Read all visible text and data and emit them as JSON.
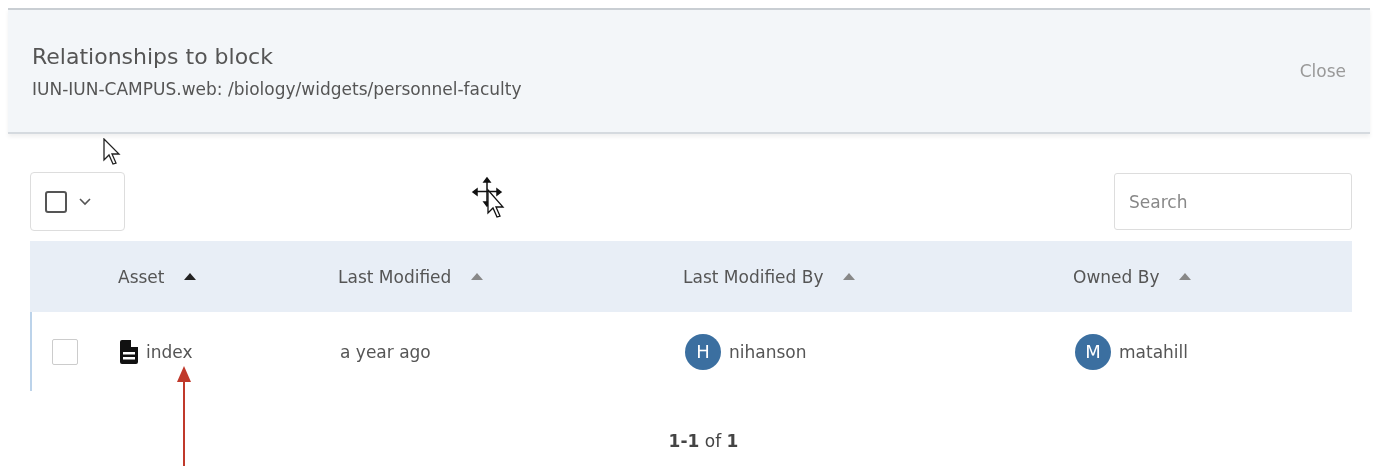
{
  "header": {
    "title": "Relationships to block",
    "subtitle": "IUN-IUN-CAMPUS.web: /biology/widgets/personnel-faculty",
    "close": "Close"
  },
  "toolbar": {
    "select_all": {
      "checked": false
    },
    "search": {
      "placeholder": "Search"
    }
  },
  "table": {
    "columns": [
      {
        "label": "Asset",
        "sorted": true
      },
      {
        "label": "Last Modified",
        "sorted": false
      },
      {
        "label": "Last Modified By",
        "sorted": false
      },
      {
        "label": "Owned By",
        "sorted": false
      }
    ],
    "rows": [
      {
        "checked": false,
        "asset": "index",
        "modified": "a year ago",
        "modified_by": {
          "initial": "H",
          "name": "nihanson"
        },
        "owned_by": {
          "initial": "M",
          "name": "matahill"
        }
      }
    ]
  },
  "pagination": "**1-1** of **1**"
}
